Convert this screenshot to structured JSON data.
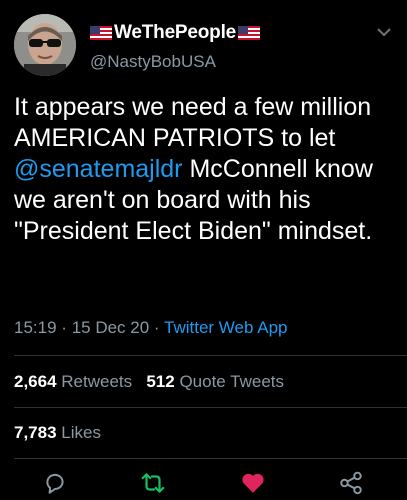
{
  "user": {
    "display_name": "WeThePeople",
    "handle": "@NastyBobUSA",
    "name_flags": [
      "us-flag-icon",
      "us-flag-icon"
    ]
  },
  "tweet": {
    "text_before": "It appears we need a few million AMERICAN PATRIOTS to let ",
    "mention": "@senatemajldr",
    "text_after": " McConnell know we aren't on board with his \"President Elect Biden\" mindset.",
    "time": "15:19",
    "date": "15 Dec 20",
    "separator": "·",
    "source": "Twitter Web App"
  },
  "stats": {
    "retweets_count": "2,664",
    "retweets_label": "Retweets",
    "quotes_count": "512",
    "quotes_label": "Quote Tweets",
    "likes_count": "7,783",
    "likes_label": "Likes"
  },
  "actions": {
    "icons": [
      "reply-icon",
      "retweet-icon",
      "like-icon",
      "share-icon"
    ],
    "retweet_color": "#17bf63",
    "like_color": "#e0245e",
    "reply_color": "#8b98a5",
    "share_color": "#8b98a5"
  },
  "colors": {
    "background": "#000000",
    "text": "#ffffff",
    "secondary": "#8b98a5",
    "link": "#1d9bf0",
    "divider": "#2f3336"
  }
}
